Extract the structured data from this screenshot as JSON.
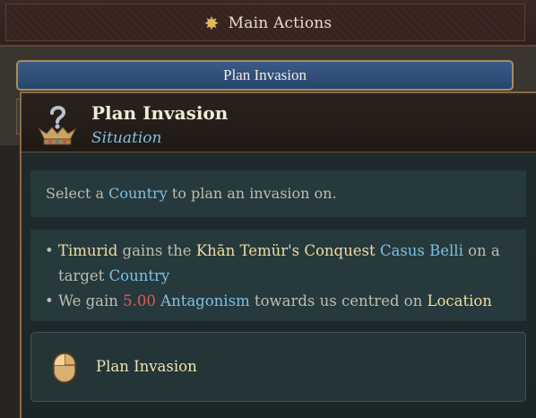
{
  "header": {
    "title": "Main Actions",
    "icon": "compass-star-icon"
  },
  "button": {
    "label": "Plan Invasion"
  },
  "tooltip": {
    "title": "Plan Invasion",
    "subtitle": "Situation",
    "icon": "crown-question-icon",
    "select_line": {
      "prefix": "Select a ",
      "country": "Country",
      "suffix": " to plan an invasion on."
    },
    "effects": {
      "bullet1": {
        "bullet": "•",
        "actor": "Timurid",
        "t1": " gains the ",
        "cb_name": "Khān Temür's Conquest",
        "t2": " ",
        "casus": "Casus Belli",
        "t3": " on a",
        "t4": "target ",
        "country": "Country"
      },
      "bullet2": {
        "bullet": "•",
        "t1": " We gain ",
        "amount": "5.00",
        "t2": " ",
        "stat": "Antagonism",
        "t3": " towards us centred on ",
        "location": "Location"
      }
    },
    "action": {
      "icon": "mouse-left-click-icon",
      "label": "Plan Invasion"
    }
  },
  "colors": {
    "highlight_yellow": "#f0dea0",
    "highlight_blue": "#7fc0e2",
    "highlight_red": "#e25a4e",
    "frame_gold": "#8a6a46"
  }
}
